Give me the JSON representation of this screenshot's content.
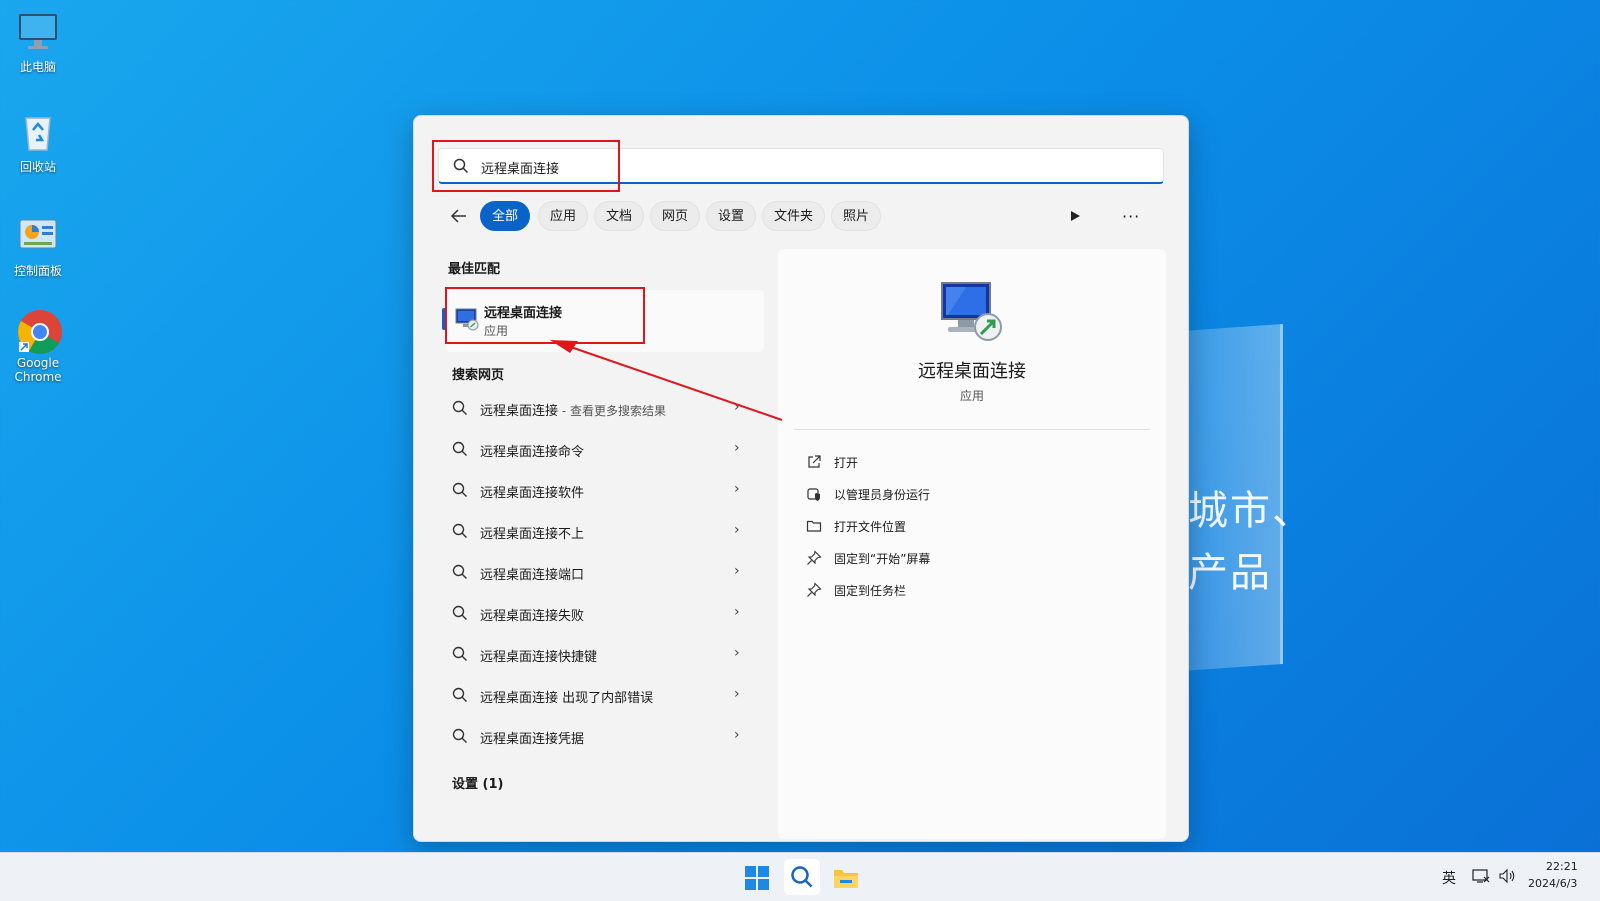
{
  "desktop": {
    "icons": [
      {
        "label": "此电脑"
      },
      {
        "label": "回收站"
      },
      {
        "label": "控制面板"
      },
      {
        "label": "Google Chrome"
      }
    ],
    "wallpaper_text_1": "城市、",
    "wallpaper_text_2": "产品"
  },
  "search": {
    "query": "远程桌面连接",
    "filters": [
      "全部",
      "应用",
      "文档",
      "网页",
      "设置",
      "文件夹",
      "照片"
    ],
    "active_filter": "全部"
  },
  "results": {
    "best_match_title": "最佳匹配",
    "best_match": {
      "name": "远程桌面连接",
      "type": "应用"
    },
    "web_title": "搜索网页",
    "web_items": [
      {
        "text": "远程桌面连接",
        "sub": " - 查看更多搜索结果"
      },
      {
        "text": "远程桌面连接命令",
        "sub": ""
      },
      {
        "text": "远程桌面连接软件",
        "sub": ""
      },
      {
        "text": "远程桌面连接不上",
        "sub": ""
      },
      {
        "text": "远程桌面连接端口",
        "sub": ""
      },
      {
        "text": "远程桌面连接失败",
        "sub": ""
      },
      {
        "text": "远程桌面连接快捷键",
        "sub": ""
      },
      {
        "text": "远程桌面连接 出现了内部错误",
        "sub": ""
      },
      {
        "text": "远程桌面连接凭据",
        "sub": ""
      }
    ],
    "settings_title": "设置 (1)"
  },
  "detail": {
    "app_name": "远程桌面连接",
    "app_type": "应用",
    "actions": [
      {
        "label": "打开",
        "icon": "open-external-icon"
      },
      {
        "label": "以管理员身份运行",
        "icon": "admin-shield-icon"
      },
      {
        "label": "打开文件位置",
        "icon": "folder-icon"
      },
      {
        "label": "固定到“开始”屏幕",
        "icon": "pin-icon"
      },
      {
        "label": "固定到任务栏",
        "icon": "pin-icon"
      }
    ]
  },
  "taskbar": {
    "ime": "英",
    "time": "22:21",
    "date": "2024/6/3"
  },
  "colors": {
    "accent": "#0a64c8",
    "annotation_red": "#e0161b"
  }
}
